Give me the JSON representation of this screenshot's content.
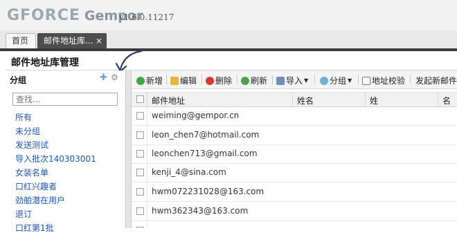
{
  "app": {
    "logo_prefix": "GFORCE",
    "logo_name": "Gempor",
    "version": "v1.6.0.11217"
  },
  "tabs": [
    {
      "label": "首页"
    },
    {
      "label": "邮件地址库...",
      "close": "×"
    }
  ],
  "page_title": "邮件地址库管理",
  "groups_panel": {
    "title": "分组",
    "add_icon": "plus-icon",
    "settings_icon": "gear-icon",
    "search_placeholder": "查找...",
    "items": [
      "所有",
      "未分组",
      "发送测试",
      "导入批次140303001",
      "女装名单",
      "口红兴趣者",
      "劲舶潜在用户",
      "退订",
      "口红第1批"
    ]
  },
  "toolbar": {
    "new": "新增",
    "edit": "编辑",
    "delete": "删除",
    "refresh": "刷新",
    "import": "导入",
    "group": "分组",
    "verify": "地址校验",
    "send": "发起新邮件"
  },
  "grid": {
    "columns": [
      "邮件地址",
      "姓名",
      "姓",
      "名"
    ],
    "rows": [
      "weiming@gempor.cn",
      "leon_chen7@hotmail.com",
      "leonchen713@gmail.com",
      "kenji_4@sina.com",
      "hwm072231028@163.com",
      "hwm362343@163.com"
    ]
  },
  "colors": {
    "link": "#1a55b8",
    "tab_active": "#4d4d4d",
    "annotation_arrow": "#2a3f66"
  }
}
